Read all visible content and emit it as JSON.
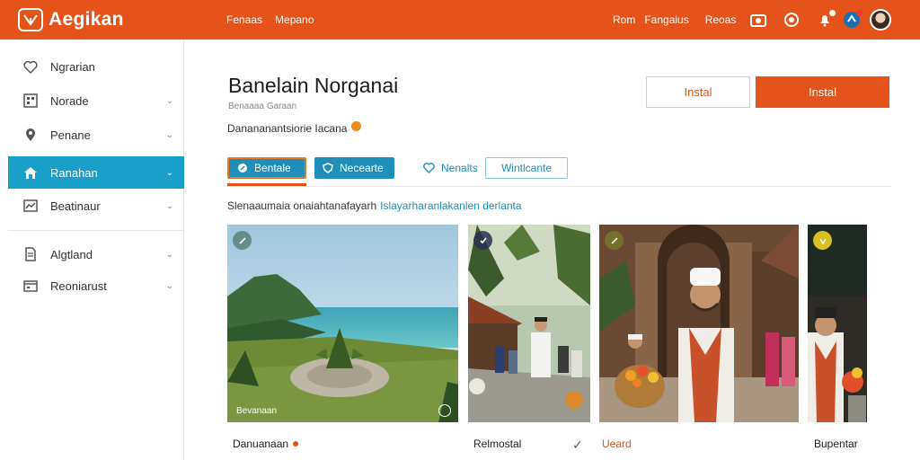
{
  "app": {
    "name": "Aegikan",
    "nav_left": [
      "Fenaas",
      "Mepano"
    ],
    "nav_right": [
      "Rom",
      "Fangaius",
      "Reoas"
    ],
    "icons": [
      "camera-icon",
      "circle-plus-icon",
      "bell-icon",
      "chat-icon",
      "avatar"
    ],
    "accent": "#e4531a",
    "active_color": "#1a9fc8"
  },
  "sidebar": {
    "items": [
      {
        "label": "Ngrarian",
        "icon": "heart-icon",
        "chevron": false
      },
      {
        "label": "Norade",
        "icon": "grid-icon",
        "chevron": true
      },
      {
        "label": "Penane",
        "icon": "location-icon",
        "chevron": true
      },
      {
        "label": "Ranahan",
        "icon": "home-icon",
        "chevron": true,
        "active": true
      },
      {
        "label": "Beatinaur",
        "icon": "chart-icon",
        "chevron": true
      },
      {
        "label": "Algtland",
        "icon": "document-icon",
        "chevron": true
      },
      {
        "label": "Reoniarust",
        "icon": "calendar-icon",
        "chevron": true
      }
    ]
  },
  "main": {
    "title": "Banelain Norganai",
    "subtitle": "Benaaaa Garaan",
    "developer": "Danananantsiorie Iacana",
    "buttons": {
      "outline": "Instal",
      "solid": "Instal"
    },
    "tabs": [
      "Bentale",
      "Necearte",
      "Nenalts",
      "Wintlcante"
    ],
    "description": "Slenaaumaia onaiahtanafayarh",
    "description_link": "Islayarharanlakanlen derlanta",
    "gallery": [
      {
        "caption": "Bevanaan",
        "label": "Danuanaan"
      },
      {
        "caption": "",
        "label": "Relmostal"
      },
      {
        "caption": "",
        "label": "Ueard"
      },
      {
        "caption": "",
        "label": "Bupentar"
      }
    ]
  }
}
